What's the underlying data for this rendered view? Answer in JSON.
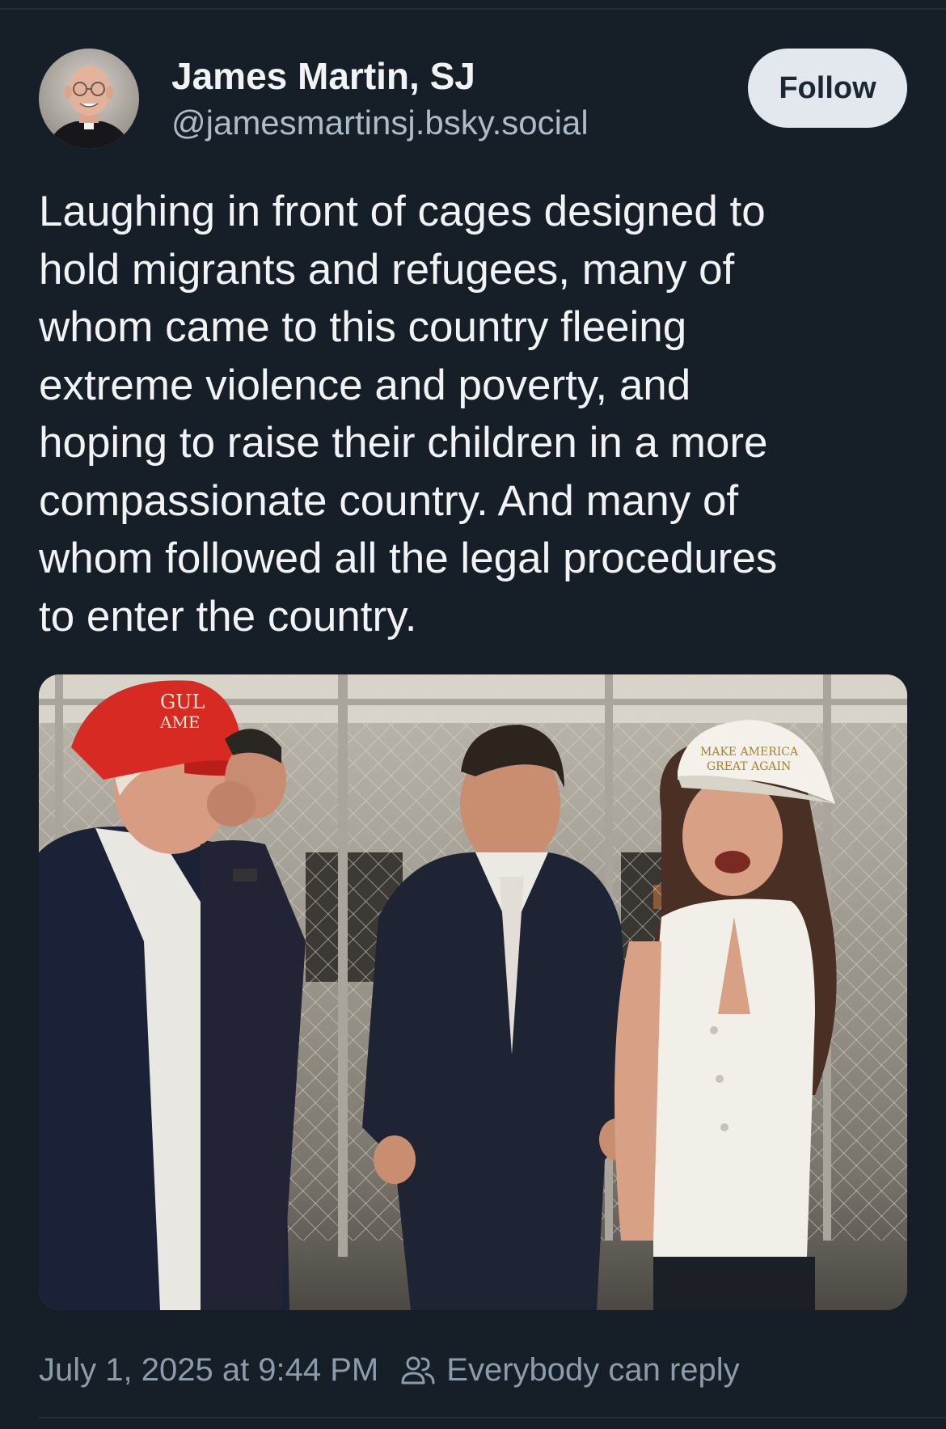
{
  "post": {
    "author_name": "James Martin, SJ",
    "author_handle": "@jamesmartinsj.bsky.social",
    "follow_label": "Follow",
    "text_lines": [
      "Laughing in front of cages designed to",
      "hold migrants and refugees, many of",
      "whom came to this country fleeing",
      "extreme violence and poverty, and",
      "hoping to raise their children in a more",
      "compassionate country. And many of",
      "whom followed all the legal procedures",
      "to enter the country."
    ],
    "timestamp": "July 1, 2025 at 9:44 PM",
    "reply_setting": "Everybody can reply"
  },
  "media": {
    "hat_red_text": [
      "GUL",
      "AME"
    ],
    "hat_white_text": [
      "MAKE AMERICA",
      "GREAT AGAIN"
    ]
  },
  "colors": {
    "background": "#161e27",
    "text": "#f1f3f5",
    "muted": "#8d9cad",
    "follow_bg": "#e3e8ee"
  },
  "icons": {
    "reply_setting_icon": "people-icon"
  }
}
